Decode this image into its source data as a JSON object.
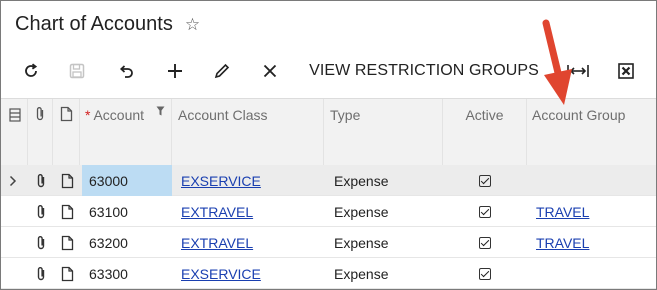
{
  "page": {
    "title": "Chart of Accounts"
  },
  "toolbar": {
    "view_restriction_groups": "VIEW RESTRICTION GROUPS"
  },
  "grid": {
    "columns": {
      "account": "Account",
      "account_class": "Account Class",
      "type": "Type",
      "active": "Active",
      "account_group": "Account Group"
    },
    "rows": [
      {
        "account": "63000",
        "account_class": "EXSERVICE",
        "type": "Expense",
        "active": true,
        "account_group": ""
      },
      {
        "account": "63100",
        "account_class": "EXTRAVEL",
        "type": "Expense",
        "active": true,
        "account_group": "TRAVEL"
      },
      {
        "account": "63200",
        "account_class": "EXTRAVEL",
        "type": "Expense",
        "active": true,
        "account_group": "TRAVEL"
      },
      {
        "account": "63300",
        "account_class": "EXSERVICE",
        "type": "Expense",
        "active": true,
        "account_group": ""
      }
    ]
  },
  "colors": {
    "accent_arrow": "#e0452f",
    "selected_cell": "#bcdcf3",
    "link": "#1a3fb0"
  }
}
